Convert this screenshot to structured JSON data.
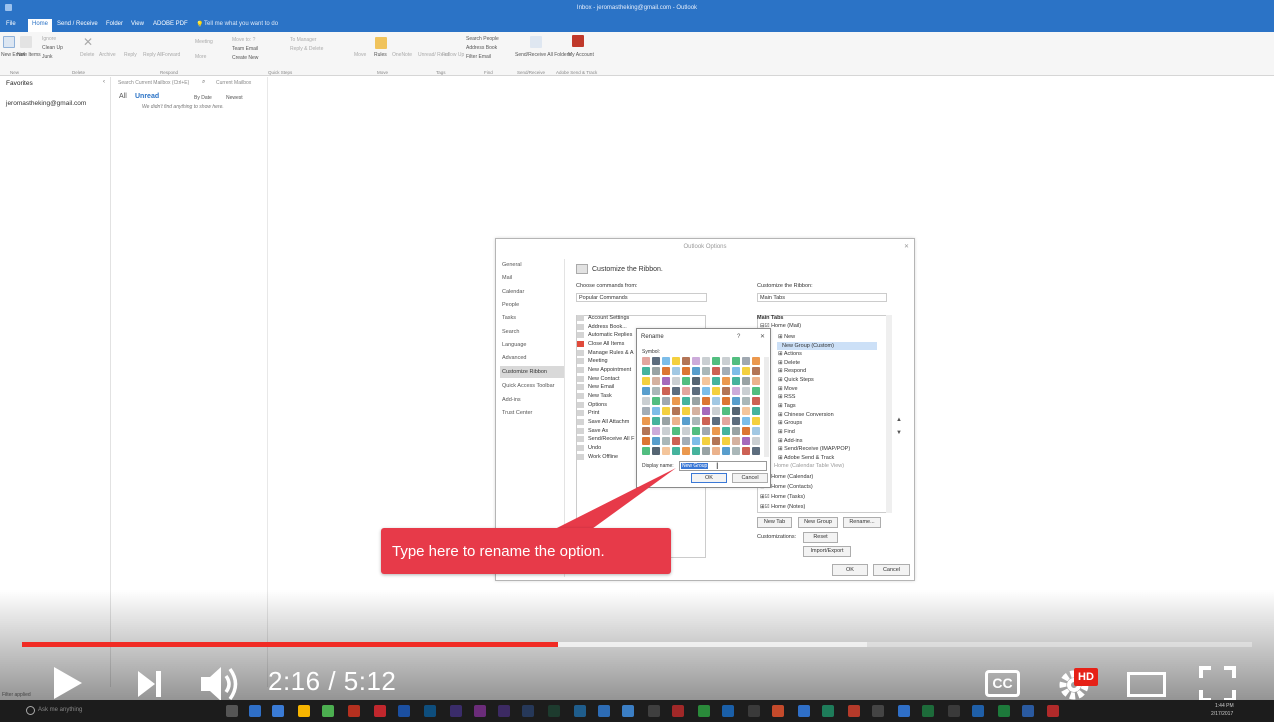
{
  "window": {
    "title": "Inbox - jeromastheking@gmail.com - Outlook"
  },
  "ribbon_tabs": [
    "File",
    "Home",
    "Send / Receive",
    "Folder",
    "View",
    "ADOBE PDF"
  ],
  "tell_me": "Tell me what you want to do",
  "ribbon": {
    "new_email": "New Email",
    "new_items": "New Items",
    "ignore": "Ignore",
    "clean_up": "Clean Up",
    "junk": "Junk",
    "delete": "Delete",
    "archive": "Archive",
    "reply": "Reply",
    "reply_all": "Reply All",
    "forward": "Forward",
    "meeting": "Meeting",
    "more": "More",
    "move_to": "Move to: ?",
    "team_email": "Team Email",
    "create_new": "Create New",
    "to_manager": "To Manager",
    "reply_delete": "Reply & Delete",
    "move": "Move",
    "rules": "Rules",
    "onenote": "OneNote",
    "unread_read": "Unread/ Read",
    "follow_up": "Follow Up",
    "search_people": "Search People",
    "address_book": "Address Book",
    "filter_email": "Filter Email",
    "send_receive_all": "Send/Receive All Folders",
    "my_account": "My Account",
    "groups": [
      "New",
      "Delete",
      "Respond",
      "Quick Steps",
      "Move",
      "Tags",
      "Find",
      "Send/Receive",
      "Adobe Send & Track"
    ]
  },
  "nav": {
    "favorites": "Favorites",
    "account": "jeromastheking@gmail.com"
  },
  "list": {
    "search_placeholder": "Search Current Mailbox (Ctrl+E)",
    "scope": "Current Mailbox",
    "filter_all": "All",
    "filter_unread": "Unread",
    "sort_by": "By Date",
    "sort_order": "Newest",
    "empty": "We didn't find anything to show here."
  },
  "options_dialog": {
    "title": "Outlook Options",
    "sidebar": [
      "General",
      "Mail",
      "Calendar",
      "People",
      "Tasks",
      "Search",
      "Language",
      "Advanced",
      "Customize Ribbon",
      "Quick Access Toolbar",
      "Add-ins",
      "Trust Center"
    ],
    "heading": "Customize the Ribbon.",
    "choose_label": "Choose commands from:",
    "choose_value": "Popular Commands",
    "customize_label": "Customize the Ribbon:",
    "customize_value": "Main Tabs",
    "commands": [
      "Account Settings",
      "Address Book...",
      "Automatic Replies",
      "Close All Items",
      "Manage Rules & A",
      "Meeting",
      "New Appointment",
      "New Contact",
      "New Email",
      "New Task",
      "Options",
      "Print",
      "Save All Attachm",
      "Save As",
      "Send/Receive All F",
      "Undo",
      "Work Offline"
    ],
    "tree_header": "Main Tabs",
    "tree": [
      "Home (Mail)",
      "New",
      "New Group (Custom)",
      "Actions",
      "Delete",
      "Respond",
      "Quick Steps",
      "Move",
      "RSS",
      "Tags",
      "Chinese Conversion",
      "Groups",
      "Find",
      "Add-ins",
      "Send/Receive (IMAP/POP)",
      "Adobe Send & Track",
      "Home (Calendar Table View)",
      "Home (Calendar)",
      "Home (Contacts)",
      "Home (Tasks)",
      "Home (Notes)"
    ],
    "new_tab": "New Tab",
    "new_group": "New Group",
    "rename": "Rename...",
    "customizations": "Customizations:",
    "reset": "Reset",
    "import_export": "Import/Export",
    "ok": "OK",
    "cancel": "Cancel"
  },
  "rename_dialog": {
    "title": "Rename",
    "help": "?",
    "close": "✕",
    "symbol_label": "Symbol:",
    "display_name_label": "Display name:",
    "display_name_value": "New Group",
    "ok": "OK",
    "cancel": "Cancel"
  },
  "callout": {
    "text": "Type here to rename the option."
  },
  "player": {
    "current": "2:16",
    "duration": "5:12",
    "time_text": "2:16 / 5:12",
    "played_fraction": 0.436,
    "buffered_fraction": 0.687,
    "cc": "CC",
    "hd": "HD"
  },
  "status": {
    "text": "Filter applied"
  },
  "taskbar": {
    "search": "Ask me anything",
    "time": "1:44 PM",
    "date": "2/17/2017"
  },
  "colors": {
    "outlook_blue": "#2b73c6",
    "progress_red": "#f12b24",
    "callout_red": "#e73a49",
    "selected_blue": "#cce0f7"
  }
}
